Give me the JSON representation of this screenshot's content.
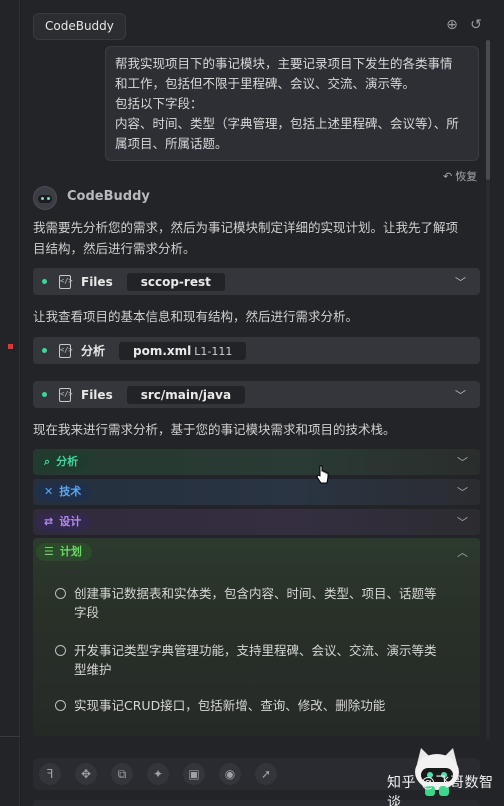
{
  "header": {
    "tab_title": "CodeBuddy",
    "icons": [
      "add-chat-icon",
      "history-icon"
    ]
  },
  "user_message": {
    "lines": [
      "帮我实现项目下的事记模块，主要记录项目下发生的各类事情",
      "和工作，包括但不限于里程碑、会议、交流、演示等。",
      "包括以下字段：",
      "内容、时间、类型（字典管理，包括上述里程碑、会议等）、所",
      "属项目、所属话题。"
    ],
    "restore_label": "恢复"
  },
  "bot": {
    "name": "CodeBuddy",
    "intro_lines": [
      "我需要先分析您的需求，然后为事记模块制定详细的实现计划。让我先了解项",
      "目结构，然后进行需求分析。"
    ],
    "step1": {
      "label": "Files",
      "chip": "sccop-rest"
    },
    "para2": "让我查看项目的基本信息和现有结构，然后进行需求分析。",
    "step2": {
      "label": "分析",
      "chip": "pom.xml",
      "chip_sub": "L1-111"
    },
    "step3": {
      "label": "Files",
      "chip": "src/main/java"
    },
    "para3": "现在我来进行需求分析，基于您的事记模块需求和项目的技术栈。"
  },
  "phases": [
    {
      "label": "分析",
      "icon": "search-icon",
      "color": "#3dd69b",
      "bg": "#244035"
    },
    {
      "label": "技术",
      "icon": "tools-icon",
      "color": "#5aa8f0",
      "bg": "#253548"
    },
    {
      "label": "设计",
      "icon": "design-icon",
      "color": "#b38af0",
      "bg": "#3a2f4a"
    },
    {
      "label": "计划",
      "icon": "list-icon",
      "color": "#6fd66a",
      "bg": "#2f4630"
    }
  ],
  "plan_items": [
    [
      "创建事记数据表和实体类，包含内容、时间、类型、项目、话题等",
      "字段"
    ],
    [
      "开发事记类型字典管理功能，支持里程碑、会议、交流、演示等类",
      "型维护"
    ],
    [
      "实现事记CRUD接口，包括新增、查询、修改、删除功能"
    ]
  ],
  "toolbar_icons": [
    "figma-icon",
    "components-icon",
    "blocks-icon",
    "magic-icon",
    "image-icon",
    "preview-icon",
    "rocket-icon"
  ],
  "watermark": "知乎 @飞哥数智谈"
}
